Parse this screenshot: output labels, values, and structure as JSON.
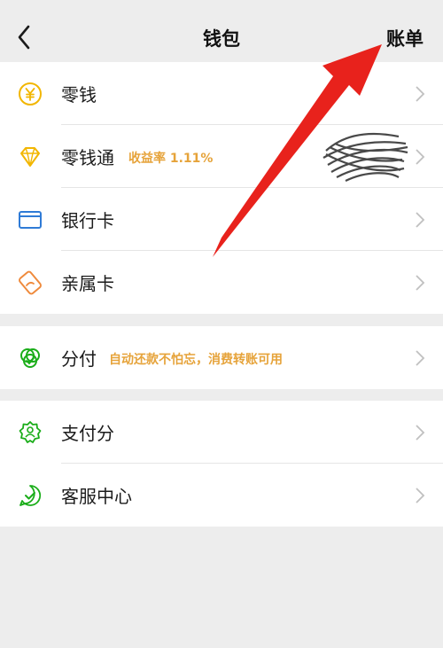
{
  "header": {
    "title": "钱包",
    "bill_label": "账单"
  },
  "section1": [
    {
      "name": "零钱",
      "icon": "yen-coin-icon"
    },
    {
      "name": "零钱通",
      "tag": "收益率 1.11%",
      "icon": "diamond-icon"
    },
    {
      "name": "银行卡",
      "icon": "bank-card-icon"
    },
    {
      "name": "亲属卡",
      "icon": "family-card-icon"
    }
  ],
  "section2": [
    {
      "name": "分付",
      "tag": "自动还款不怕忘，消费转账可用",
      "icon": "installment-icon"
    }
  ],
  "section3": [
    {
      "name": "支付分",
      "icon": "pay-score-icon"
    },
    {
      "name": "客服中心",
      "icon": "customer-service-icon"
    }
  ],
  "colors": {
    "accent_orange": "#e6a33a",
    "green": "#1aad19",
    "yellow": "#f2b600",
    "blue": "#2f7bd6",
    "arrow_red": "#e8221c"
  }
}
